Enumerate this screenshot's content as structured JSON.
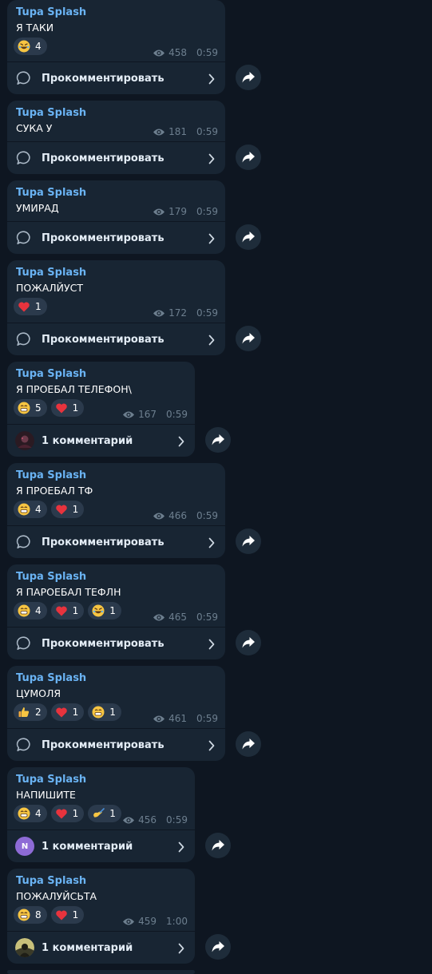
{
  "channel": {
    "author": "Tupa Splash"
  },
  "labels": {
    "comment_prompt": "Прокомментировать"
  },
  "colors": {
    "background": "#0e1621",
    "bubble": "#182533",
    "author": "#6ab3f3",
    "meta": "#6d7f8f",
    "reaction_bg": "#2b3a4c"
  },
  "messages": [
    {
      "text": "Я ТАКИ",
      "reactions": [
        {
          "emoji": "rofl-emoji",
          "count": "4"
        }
      ],
      "views": "458",
      "time": "0:59",
      "comment": {
        "type": "prompt",
        "label": "Прокомментировать"
      }
    },
    {
      "text": "СУКА У",
      "reactions": [],
      "views": "181",
      "time": "0:59",
      "comment": {
        "type": "prompt",
        "label": "Прокомментировать"
      }
    },
    {
      "text": "УМИРАД",
      "reactions": [],
      "views": "179",
      "time": "0:59",
      "comment": {
        "type": "prompt",
        "label": "Прокомментировать"
      }
    },
    {
      "text": "ПОЖАЛЙУСТ",
      "reactions": [
        {
          "emoji": "heart-emoji",
          "count": "1"
        }
      ],
      "views": "172",
      "time": "0:59",
      "comment": {
        "type": "prompt",
        "label": "Прокомментировать"
      }
    },
    {
      "text": "Я ПРОЕБАЛ ТЕЛЕФОН\\",
      "reactions": [
        {
          "emoji": "grin-emoji",
          "count": "5"
        },
        {
          "emoji": "heart-emoji",
          "count": "1"
        }
      ],
      "views": "167",
      "time": "0:59",
      "comment": {
        "type": "count",
        "label": "1 комментарий",
        "avatar": "dark-avatar"
      }
    },
    {
      "text": "Я ПРОЕБАЛ ТФ",
      "reactions": [
        {
          "emoji": "grin-emoji",
          "count": "4"
        },
        {
          "emoji": "heart-emoji",
          "count": "1"
        }
      ],
      "views": "466",
      "time": "0:59",
      "comment": {
        "type": "prompt",
        "label": "Прокомментировать"
      }
    },
    {
      "text": "Я ПАРОЕБАЛ ТЕФЛН",
      "reactions": [
        {
          "emoji": "grin-emoji",
          "count": "4"
        },
        {
          "emoji": "heart-emoji",
          "count": "1"
        },
        {
          "emoji": "rofl-emoji",
          "count": "1"
        }
      ],
      "views": "465",
      "time": "0:59",
      "comment": {
        "type": "prompt",
        "label": "Прокомментировать"
      }
    },
    {
      "text": "ЦУМОЛЯ",
      "reactions": [
        {
          "emoji": "thumbs-up-emoji",
          "count": "2"
        },
        {
          "emoji": "heart-emoji",
          "count": "1"
        },
        {
          "emoji": "grin-emoji",
          "count": "1"
        }
      ],
      "views": "461",
      "time": "0:59",
      "comment": {
        "type": "prompt",
        "label": "Прокомментировать"
      }
    },
    {
      "text": "НАПИШИТЕ",
      "reactions": [
        {
          "emoji": "grin-emoji",
          "count": "4"
        },
        {
          "emoji": "heart-emoji",
          "count": "1"
        },
        {
          "emoji": "writing-hand-emoji",
          "count": "1"
        }
      ],
      "views": "456",
      "time": "0:59",
      "comment": {
        "type": "count",
        "label": "1 комментарий",
        "avatar": "letter-avatar",
        "avatar_letter": "N"
      }
    },
    {
      "text": "ПОЖАЛУЙСЬТА",
      "reactions": [
        {
          "emoji": "grin-emoji",
          "count": "8"
        },
        {
          "emoji": "heart-emoji",
          "count": "1"
        }
      ],
      "views": "459",
      "time": "1:00",
      "comment": {
        "type": "count",
        "label": "1 комментарий",
        "avatar": "photo-avatar"
      }
    }
  ]
}
